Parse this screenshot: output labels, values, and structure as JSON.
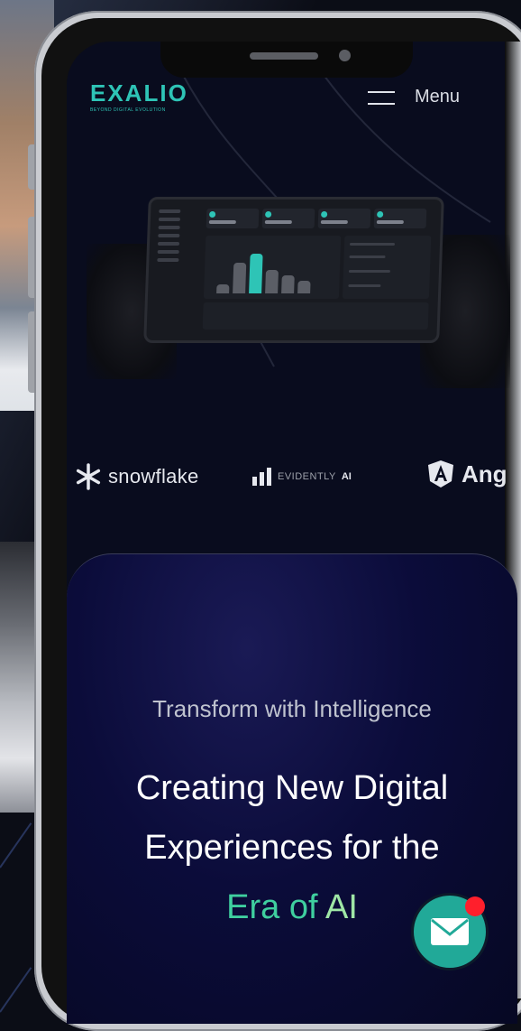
{
  "brand": {
    "logo_text": "EXALIO",
    "logo_tagline": "BEYOND DIGITAL EVOLUTION"
  },
  "nav": {
    "menu_label": "Menu"
  },
  "partners": [
    {
      "name": "snowflake"
    },
    {
      "name": "EVIDENTLY",
      "suffix": "AI"
    },
    {
      "name": "Ang"
    }
  ],
  "hero": {
    "kicker": "Transform with Intelligence",
    "headline_line1": "Creating New Digital",
    "headline_line2": "Experiences for the",
    "headline_accent_1": "Era of ",
    "headline_accent_2": "AI"
  },
  "colors": {
    "accent": "#2ec4b6",
    "fab": "#21a998",
    "notification": "#ff1f2c",
    "card_bg": "#0b0c3a"
  },
  "icons": {
    "menu": "hamburger-icon",
    "contact": "mail-icon",
    "snowflake": "snowflake-logo-icon",
    "evidently": "evidently-bars-icon",
    "angular": "angular-logo-icon"
  }
}
